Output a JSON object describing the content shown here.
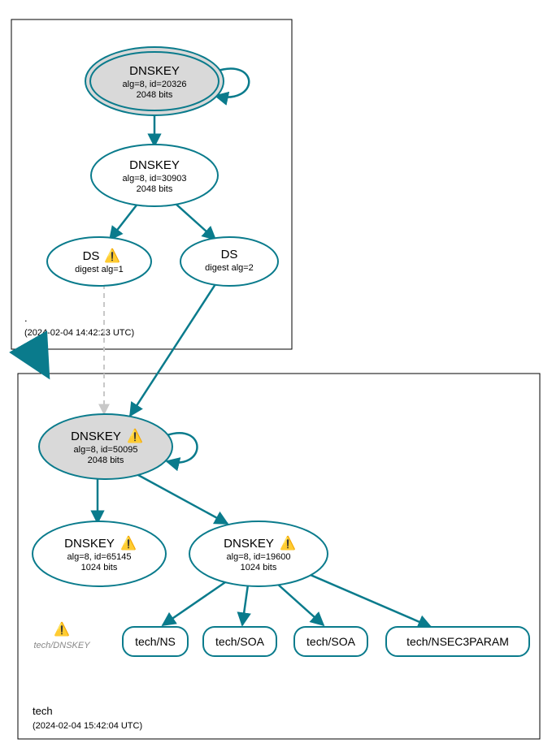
{
  "colors": {
    "stroke": "#0a7b8c",
    "fill_key": "#d9d9d9",
    "fill_white": "#ffffff",
    "text": "#000000",
    "gray": "#888888",
    "dashed": "#b8b8b8"
  },
  "zones": {
    "root": {
      "label": ".",
      "timestamp": "(2024-02-04 14:42:23 UTC)"
    },
    "tech": {
      "label": "tech",
      "timestamp": "(2024-02-04 15:42:04 UTC)"
    }
  },
  "nodes": {
    "root_ksk": {
      "title": "DNSKEY",
      "line1": "alg=8, id=20326",
      "line2": "2048 bits"
    },
    "root_zsk": {
      "title": "DNSKEY",
      "line1": "alg=8, id=30903",
      "line2": "2048 bits"
    },
    "ds1": {
      "title": "DS",
      "warn": "⚠️",
      "sub": "digest alg=1"
    },
    "ds2": {
      "title": "DS",
      "sub": "digest alg=2"
    },
    "tech_ksk": {
      "title": "DNSKEY",
      "warn": "⚠️",
      "line1": "alg=8, id=50095",
      "line2": "2048 bits"
    },
    "tech_zsk1": {
      "title": "DNSKEY",
      "warn": "⚠️",
      "line1": "alg=8, id=65145",
      "line2": "1024 bits"
    },
    "tech_zsk2": {
      "title": "DNSKEY",
      "warn": "⚠️",
      "line1": "alg=8, id=19600",
      "line2": "1024 bits"
    },
    "tech_dnskey_gray": {
      "warn": "⚠️",
      "label": "tech/DNSKEY"
    }
  },
  "rrsets": {
    "ns": "tech/NS",
    "soa1": "tech/SOA",
    "soa2": "tech/SOA",
    "nsec3": "tech/NSEC3PARAM"
  }
}
